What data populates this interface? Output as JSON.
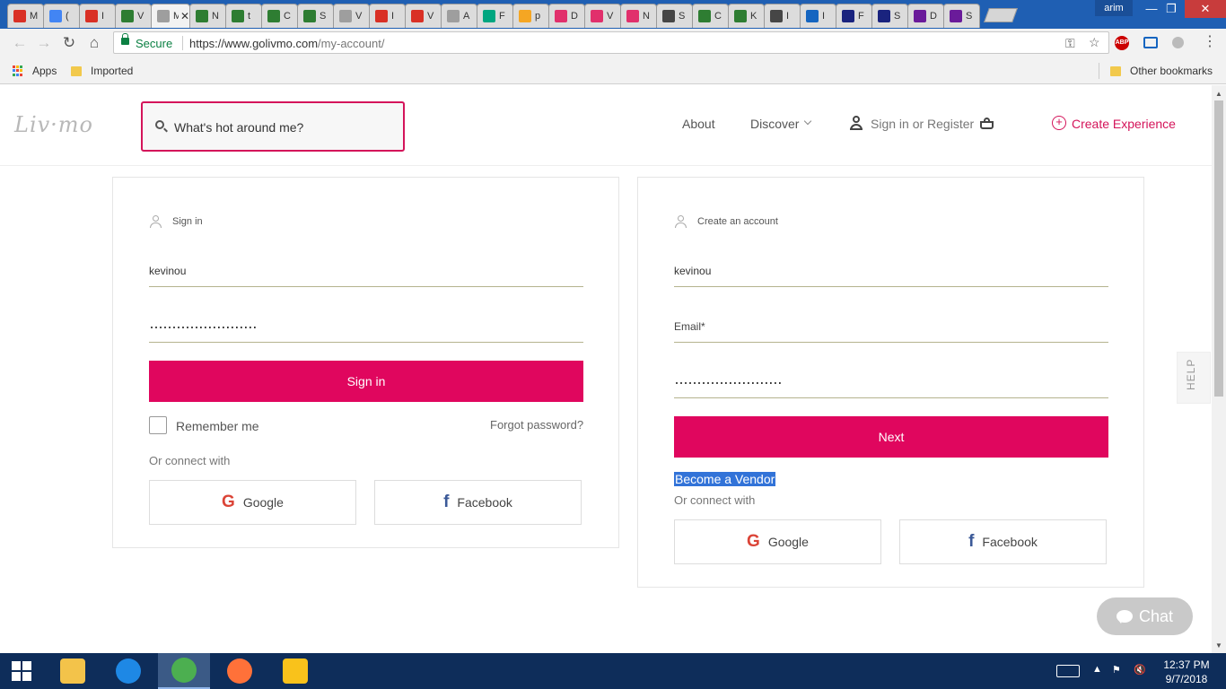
{
  "browser": {
    "tabs": [
      {
        "icon": "gmail-icon",
        "label": "M I",
        "color": "#d93025"
      },
      {
        "icon": "inbox-icon",
        "label": "(",
        "color": "#4285f4"
      },
      {
        "icon": "gmail-icon",
        "label": "I",
        "color": "#d93025"
      },
      {
        "icon": "livmo-icon",
        "label": "V",
        "color": "#2e7d32"
      },
      {
        "icon": "tab-active-icon",
        "label": "M",
        "color": "#9e9e9e"
      },
      {
        "icon": "livmo-icon",
        "label": "N",
        "color": "#2e7d32"
      },
      {
        "icon": "livmo-icon",
        "label": "t",
        "color": "#2e7d32"
      },
      {
        "icon": "livmo-icon",
        "label": "C",
        "color": "#2e7d32"
      },
      {
        "icon": "livmo-icon",
        "label": "S",
        "color": "#2e7d32"
      },
      {
        "icon": "page-icon",
        "label": "V",
        "color": "#9e9e9e"
      },
      {
        "icon": "gmail-icon",
        "label": "I",
        "color": "#d93025"
      },
      {
        "icon": "gmail-icon",
        "label": "V",
        "color": "#d93025"
      },
      {
        "icon": "page-icon",
        "label": "A",
        "color": "#9e9e9e"
      },
      {
        "icon": "tripadvisor-icon",
        "label": "F",
        "color": "#00a680"
      },
      {
        "icon": "pma-icon",
        "label": "p",
        "color": "#f5a623"
      },
      {
        "icon": "instagram-icon",
        "label": "D",
        "color": "#e1306c"
      },
      {
        "icon": "instagram-icon",
        "label": "V",
        "color": "#e1306c"
      },
      {
        "icon": "instagram-icon",
        "label": "N",
        "color": "#e1306c"
      },
      {
        "icon": "wordpress-icon",
        "label": "S",
        "color": "#464646"
      },
      {
        "icon": "livmo-icon",
        "label": "C",
        "color": "#2e7d32"
      },
      {
        "icon": "livmo-icon",
        "label": "K",
        "color": "#2e7d32"
      },
      {
        "icon": "wordpress-icon",
        "label": "I",
        "color": "#464646"
      },
      {
        "icon": "ibb-icon",
        "label": "I",
        "color": "#1565c0"
      },
      {
        "icon": "grid-icon",
        "label": "F",
        "color": "#1a237e"
      },
      {
        "icon": "grid-icon",
        "label": "S",
        "color": "#1a237e"
      },
      {
        "icon": "store-icon",
        "label": "D",
        "color": "#6a1b9a"
      },
      {
        "icon": "store-icon",
        "label": "S",
        "color": "#6a1b9a"
      }
    ],
    "active_tab_index": 4,
    "profile": "arim",
    "window_buttons": {
      "minimize": "—",
      "maximize": "❐",
      "close": "✕"
    },
    "secure_label": "Secure",
    "url_host": "https://www.golivmo.com",
    "url_path": "/my-account/",
    "bookmarks": {
      "apps": "Apps",
      "imported": "Imported",
      "other": "Other bookmarks"
    }
  },
  "header": {
    "logo": "Liv·mo",
    "search_placeholder": "What's hot around me?",
    "nav_about": "About",
    "nav_discover": "Discover",
    "nav_signin": "Sign in or Register",
    "nav_create": "Create Experience"
  },
  "signin": {
    "heading": "Sign in",
    "username": "kevinou",
    "password": "························",
    "button": "Sign in",
    "remember": "Remember me",
    "forgot": "Forgot password?",
    "connect": "Or connect with",
    "google": "Google",
    "facebook": "Facebook"
  },
  "register": {
    "heading": "Create an account",
    "username": "kevinou",
    "email_placeholder": "Email*",
    "password": "························",
    "button": "Next",
    "vendor_link": "Become a Vendor",
    "connect": "Or connect with",
    "google": "Google",
    "facebook": "Facebook"
  },
  "widgets": {
    "help": "HELP",
    "chat": "Chat"
  },
  "taskbar": {
    "time": "12:37 PM",
    "date": "9/7/2018",
    "apps": [
      {
        "name": "file-explorer",
        "color": "#f3c34a"
      },
      {
        "name": "internet-explorer",
        "color": "#1e88e5"
      },
      {
        "name": "chrome",
        "color": "#4caf50"
      },
      {
        "name": "firefox",
        "color": "#ff7139"
      },
      {
        "name": "je-app",
        "color": "#f9c21b"
      }
    ]
  },
  "colors": {
    "brand": "#e0065e",
    "accent": "#d4145a"
  }
}
